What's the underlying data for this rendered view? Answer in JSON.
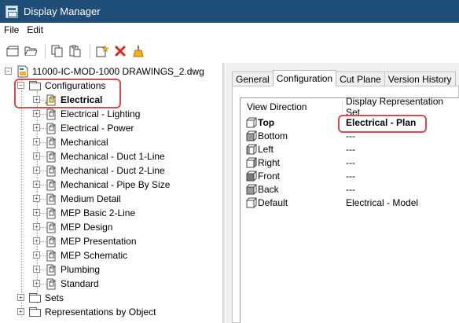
{
  "window": {
    "title": "Display Manager"
  },
  "menu": {
    "items": [
      "File",
      "Edit"
    ]
  },
  "toolbar": {
    "icons": [
      "new-icon",
      "open-icon",
      "copy-icon",
      "paste-icon",
      "new-config-icon",
      "delete-icon",
      "purge-icon"
    ]
  },
  "tree": {
    "root": "11000-IC-MOD-1000 DRAWINGS_2.dwg",
    "configurations_label": "Configurations",
    "configurations": [
      "Electrical",
      "Electrical - Lighting",
      "Electrical - Power",
      "Mechanical",
      "Mechanical - Duct 1-Line",
      "Mechanical - Duct 2-Line",
      "Mechanical - Pipe By Size",
      "Medium Detail",
      "MEP Basic 2-Line",
      "MEP Design",
      "MEP Presentation",
      "MEP Schematic",
      "Plumbing",
      "Standard"
    ],
    "sets_label": "Sets",
    "reps_label": "Representations by Object",
    "selected": "Electrical"
  },
  "tabs": [
    "General",
    "Configuration",
    "Cut Plane",
    "Version History"
  ],
  "active_tab": "Configuration",
  "config_table": {
    "headers": [
      "View Direction",
      "Display Representation Set"
    ],
    "rows": [
      {
        "direction": "Top",
        "rep": "Electrical - Plan",
        "bold": true
      },
      {
        "direction": "Bottom",
        "rep": "---"
      },
      {
        "direction": "Left",
        "rep": "---"
      },
      {
        "direction": "Right",
        "rep": "---"
      },
      {
        "direction": "Front",
        "rep": "---"
      },
      {
        "direction": "Back",
        "rep": "---"
      },
      {
        "direction": "Default",
        "rep": "Electrical - Model"
      }
    ]
  },
  "colors": {
    "titlebar": "#1f4e79",
    "highlight": "#e0474c"
  }
}
